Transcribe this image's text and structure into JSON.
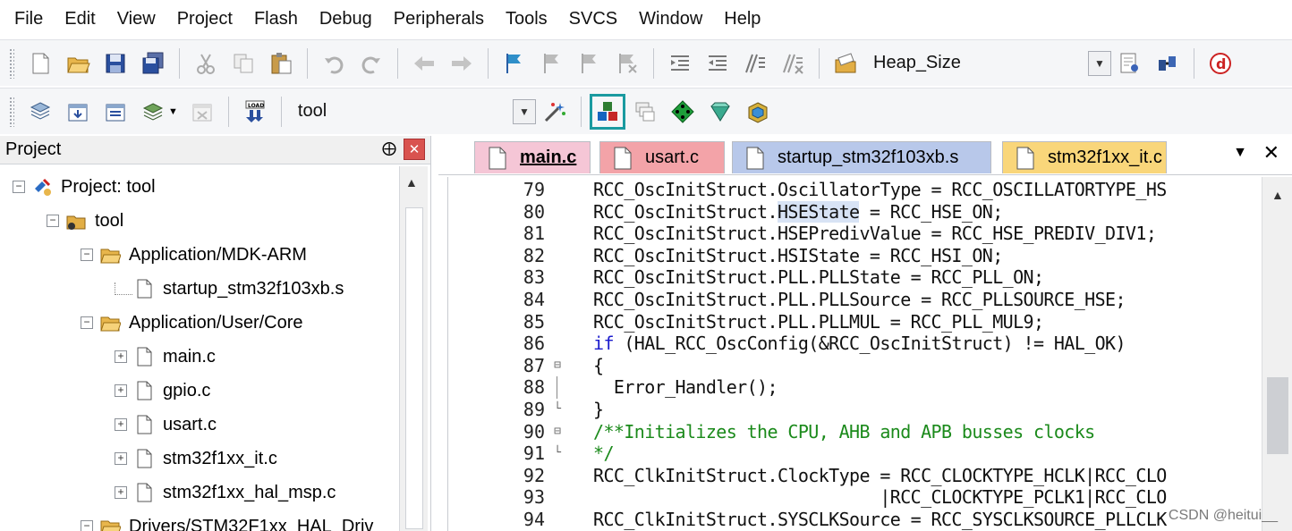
{
  "menu": [
    "File",
    "Edit",
    "View",
    "Project",
    "Flash",
    "Debug",
    "Peripherals",
    "Tools",
    "SVCS",
    "Window",
    "Help"
  ],
  "toolbar1": {
    "combo_value": "Heap_Size"
  },
  "toolbar2": {
    "target_value": "tool"
  },
  "project": {
    "title": "Project",
    "pin": "⨁",
    "close": "✕",
    "items": [
      {
        "label": "Project: tool",
        "toggle": "−",
        "icon": "project-icon"
      },
      {
        "label": "tool",
        "toggle": "−",
        "icon": "target-folder-icon"
      },
      {
        "label": "Application/MDK-ARM",
        "toggle": "−",
        "icon": "folder-icon"
      },
      {
        "label": "startup_stm32f103xb.s",
        "toggle": "",
        "icon": "file-icon"
      },
      {
        "label": "Application/User/Core",
        "toggle": "−",
        "icon": "folder-icon"
      },
      {
        "label": "main.c",
        "toggle": "+",
        "icon": "file-icon"
      },
      {
        "label": "gpio.c",
        "toggle": "+",
        "icon": "file-icon"
      },
      {
        "label": "usart.c",
        "toggle": "+",
        "icon": "file-icon"
      },
      {
        "label": "stm32f1xx_it.c",
        "toggle": "+",
        "icon": "file-icon"
      },
      {
        "label": "stm32f1xx_hal_msp.c",
        "toggle": "+",
        "icon": "file-icon"
      },
      {
        "label": "Drivers/STM32F1xx_HAL_Driv",
        "toggle": "−",
        "icon": "folder-icon"
      }
    ]
  },
  "tabs": [
    {
      "label": "main.c",
      "active": true
    },
    {
      "label": "usart.c"
    },
    {
      "label": "startup_stm32f103xb.s"
    },
    {
      "label": "stm32f1xx_it.c"
    }
  ],
  "tab_controls": {
    "menu": "▼",
    "close": "✕"
  },
  "code_lines": [
    {
      "num": "79",
      "text": "RCC_OscInitStruct.OscillatorType = RCC_OSCILLATORTYPE_HS"
    },
    {
      "num": "80",
      "pre": "RCC_OscInitStruct.",
      "hl": "HSEState",
      "post": " = RCC_HSE_ON;"
    },
    {
      "num": "81",
      "text": "RCC_OscInitStruct.HSEPredivValue = RCC_HSE_PREDIV_DIV1;"
    },
    {
      "num": "82",
      "text": "RCC_OscInitStruct.HSIState = RCC_HSI_ON;"
    },
    {
      "num": "83",
      "text": "RCC_OscInitStruct.PLL.PLLState = RCC_PLL_ON;"
    },
    {
      "num": "84",
      "text": "RCC_OscInitStruct.PLL.PLLSource = RCC_PLLSOURCE_HSE;"
    },
    {
      "num": "85",
      "text": "RCC_OscInitStruct.PLL.PLLMUL = RCC_PLL_MUL9;"
    },
    {
      "num": "86",
      "kw": "if",
      "post": " (HAL_RCC_OscConfig(&RCC_OscInitStruct) != HAL_OK)"
    },
    {
      "num": "87",
      "text": "{",
      "fold": "⊟"
    },
    {
      "num": "88",
      "text": "  Error_Handler();"
    },
    {
      "num": "89",
      "text": "}",
      "fold": "└"
    },
    {
      "num": "90",
      "comment": "/**Initializes the CPU, AHB and APB busses clocks",
      "fold": "⊟"
    },
    {
      "num": "91",
      "comment": "*/",
      "fold": "└"
    },
    {
      "num": "92",
      "text": "RCC_ClkInitStruct.ClockType = RCC_CLOCKTYPE_HCLK|RCC_CLO"
    },
    {
      "num": "93",
      "text": "                            |RCC_CLOCKTYPE_PCLK1|RCC_CLO"
    },
    {
      "num": "94",
      "text": "RCC_ClkInitStruct.SYSCLKSource = RCC_SYSCLKSOURCE_PLLCLK"
    }
  ],
  "watermark": "CSDN @heitui__",
  "colors": {
    "highlight_box": "#1a9aa0",
    "keyword": "#1a1acc",
    "comment": "#1b8a1b"
  }
}
